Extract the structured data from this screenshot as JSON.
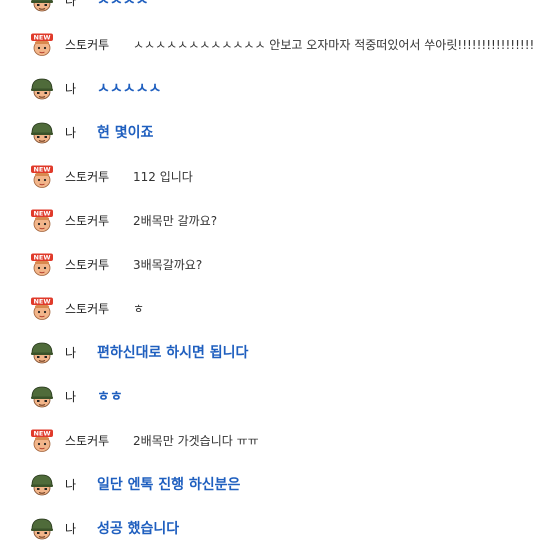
{
  "chat": {
    "messages": [
      {
        "speaker": "나",
        "type": "me",
        "avatar": "soldier-helmet-icon",
        "text": "ㅅㅅㅅㅅ"
      },
      {
        "speaker": "스토커투",
        "type": "other",
        "avatar": "new-badge-face-icon",
        "text": "ㅅㅅㅅㅅㅅㅅㅅㅅㅅㅅㅅㅅ 안보고 오자마자 적중떠있어서 쑤아릿!!!!!!!!!!!!!!!!"
      },
      {
        "speaker": "나",
        "type": "me",
        "avatar": "soldier-helmet-icon",
        "text": "ㅅㅅㅅㅅㅅ"
      },
      {
        "speaker": "나",
        "type": "me",
        "avatar": "soldier-helmet-icon",
        "text": "현 몇이죠"
      },
      {
        "speaker": "스토커투",
        "type": "other",
        "avatar": "new-badge-face-icon",
        "text": "112 입니다"
      },
      {
        "speaker": "스토커투",
        "type": "other",
        "avatar": "new-badge-face-icon",
        "text": "2배목만 갈까요?"
      },
      {
        "speaker": "스토커투",
        "type": "other",
        "avatar": "new-badge-face-icon",
        "text": "3배목갈까요?"
      },
      {
        "speaker": "스토커투",
        "type": "other",
        "avatar": "new-badge-face-icon",
        "text": "ㅎ"
      },
      {
        "speaker": "나",
        "type": "me",
        "avatar": "soldier-helmet-icon",
        "text": "편하신대로 하시면 됩니다"
      },
      {
        "speaker": "나",
        "type": "me",
        "avatar": "soldier-helmet-icon",
        "text": "ㅎㅎ"
      },
      {
        "speaker": "스토커투",
        "type": "other",
        "avatar": "new-badge-face-icon",
        "text": "2배목만 가겟습니다 ㅠㅠ"
      },
      {
        "speaker": "나",
        "type": "me",
        "avatar": "soldier-helmet-icon",
        "text": "일단 엔톡 진행 하신분은"
      },
      {
        "speaker": "나",
        "type": "me",
        "avatar": "soldier-helmet-icon",
        "text": "성공 했습니다"
      }
    ],
    "badge_text": "NEW",
    "colors": {
      "my_message": "#1f5fbf",
      "other_message": "#333333",
      "speaker_name": "#222222",
      "badge_red": "#e03a2a",
      "helmet_green": "#4f6b3a",
      "skin": "#f2b58a"
    }
  }
}
